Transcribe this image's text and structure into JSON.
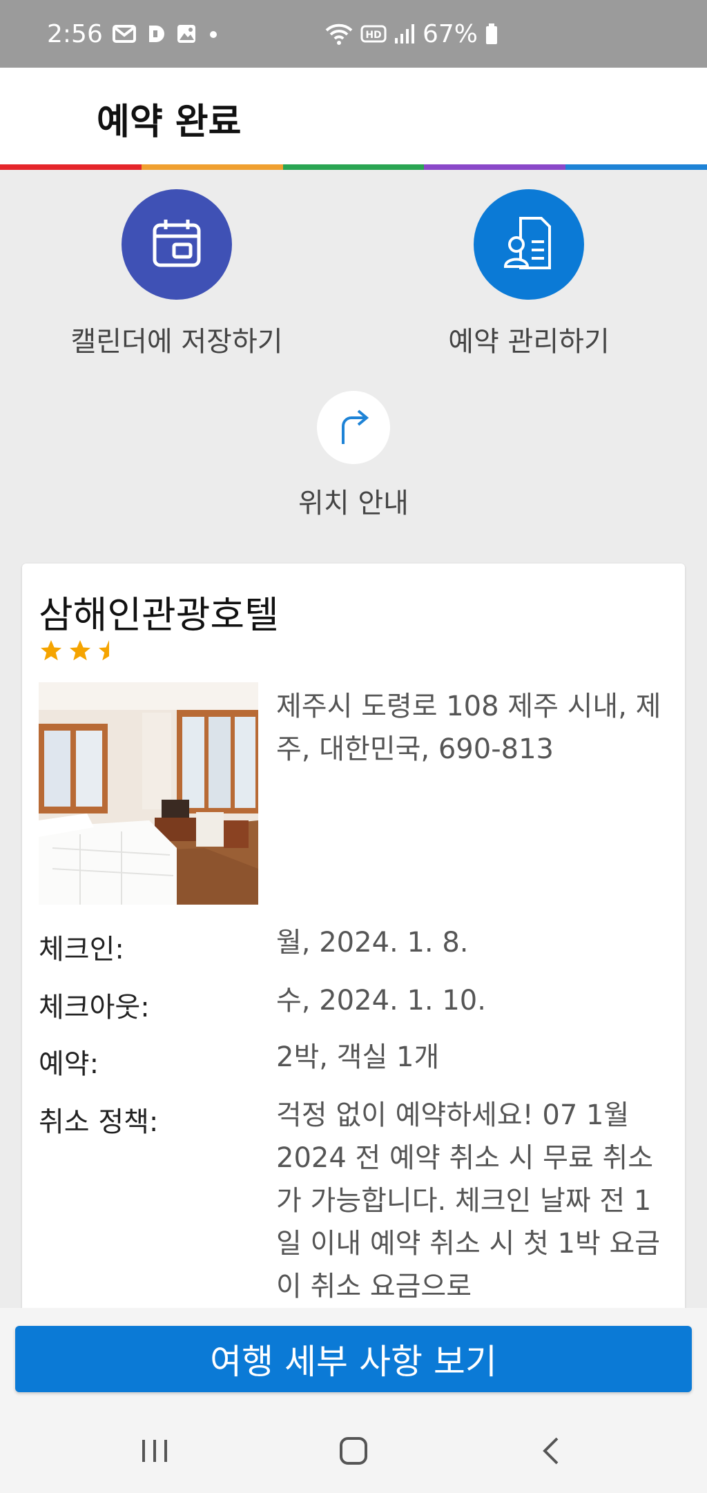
{
  "status_bar": {
    "time": "2:56",
    "battery": "67%",
    "icons": [
      "mail-icon",
      "d-app-icon",
      "gallery-icon",
      "dot-icon",
      "wifi-icon",
      "hd-icon",
      "signal-icon",
      "battery-icon"
    ]
  },
  "header": {
    "title": "예약 완료"
  },
  "rainbow_colors": [
    "#e5262b",
    "#f0a030",
    "#2aa552",
    "#8a48c9",
    "#1e83d6"
  ],
  "actions": {
    "calendar": {
      "label": "캘린더에 저장하기",
      "color": "#3f51b5",
      "icon": "calendar-icon"
    },
    "manage": {
      "label": "예약 관리하기",
      "color": "#0b7ad6",
      "icon": "manage-booking-icon"
    },
    "directions": {
      "label": "위치 안내",
      "color": "#ffffff",
      "icon": "directions-arrow-icon"
    }
  },
  "hotel": {
    "name": "삼해인관광호텔",
    "rating": 2.5,
    "address": "제주시 도령로 108 제주 시내, 제주, 대한민국, 690-813",
    "details": [
      {
        "label": "체크인:",
        "value": "월, 2024. 1. 8."
      },
      {
        "label": "체크아웃:",
        "value": "수, 2024. 1. 10."
      },
      {
        "label": "예약:",
        "value": "2박, 객실 1개"
      },
      {
        "label": "취소 정책:",
        "value": "걱정 없이 예약하세요! 07 1월 2024 전 예약 취소 시 무료 취소가 가능합니다.  체크인 날짜 전 1일 이내 예약 취소 시 첫 1박 요금이 취소 요금으로"
      }
    ]
  },
  "cta": {
    "label": "여행 세부 사항 보기",
    "color": "#0b7ad6"
  },
  "navbar": {
    "icons": [
      "recent-apps-icon",
      "home-icon",
      "back-icon"
    ]
  }
}
